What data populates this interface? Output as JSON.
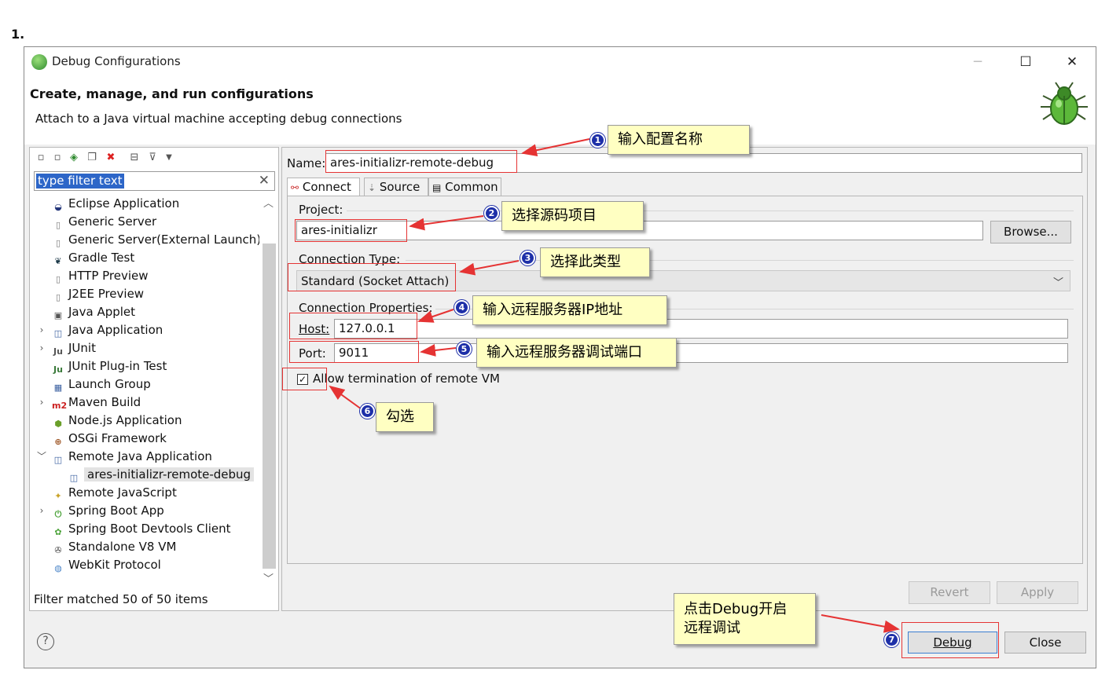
{
  "step_label": "1.",
  "window": {
    "title": "Debug Configurations",
    "header_title": "Create, manage, and run configurations",
    "header_subtitle": "Attach to a Java virtual machine accepting debug connections"
  },
  "left": {
    "filter_placeholder": "type filter text",
    "tree": [
      {
        "label": "Eclipse Application",
        "icon": "eclipse-icon",
        "expandable": false
      },
      {
        "label": "Generic Server",
        "icon": "server-icon",
        "expandable": false
      },
      {
        "label": "Generic Server(External Launch)",
        "icon": "server-icon",
        "expandable": false
      },
      {
        "label": "Gradle Test",
        "icon": "gradle-icon",
        "expandable": false
      },
      {
        "label": "HTTP Preview",
        "icon": "server-icon",
        "expandable": false
      },
      {
        "label": "J2EE Preview",
        "icon": "server-icon",
        "expandable": false
      },
      {
        "label": "Java Applet",
        "icon": "applet-icon",
        "expandable": false
      },
      {
        "label": "Java Application",
        "icon": "java-app-icon",
        "expandable": true
      },
      {
        "label": "JUnit",
        "icon": "junit-icon",
        "expandable": true
      },
      {
        "label": "JUnit Plug-in Test",
        "icon": "junit-plugin-icon",
        "expandable": false
      },
      {
        "label": "Launch Group",
        "icon": "launch-group-icon",
        "expandable": false
      },
      {
        "label": "Maven Build",
        "icon": "maven-icon",
        "expandable": true
      },
      {
        "label": "Node.js Application",
        "icon": "nodejs-icon",
        "expandable": false
      },
      {
        "label": "OSGi Framework",
        "icon": "osgi-icon",
        "expandable": false
      },
      {
        "label": "Remote Java Application",
        "icon": "remote-java-icon",
        "expandable": true,
        "expanded": true
      },
      {
        "label": "ares-initializr-remote-debug",
        "icon": "remote-java-icon",
        "child": true,
        "selected": true
      },
      {
        "label": "Remote JavaScript",
        "icon": "remote-js-icon",
        "expandable": false
      },
      {
        "label": "Spring Boot App",
        "icon": "spring-boot-icon",
        "expandable": true
      },
      {
        "label": "Spring Boot Devtools Client",
        "icon": "spring-devtools-icon",
        "expandable": false
      },
      {
        "label": "Standalone V8 VM",
        "icon": "v8-icon",
        "expandable": false
      },
      {
        "label": "WebKit Protocol",
        "icon": "webkit-icon",
        "expandable": false
      }
    ],
    "filter_status": "Filter matched 50 of 50 items"
  },
  "form": {
    "name_label": "Name:",
    "name_value": "ares-initializr-remote-debug",
    "tabs": [
      "Connect",
      "Source",
      "Common"
    ],
    "active_tab": "Connect",
    "project_label": "Project:",
    "project_value": "ares-initializr",
    "browse_label": "Browse...",
    "connection_type_label": "Connection Type:",
    "connection_type_value": "Standard (Socket Attach)",
    "connection_props_label": "Connection Properties:",
    "host_label": "Host:",
    "host_value": "127.0.0.1",
    "port_label": "Port:",
    "port_value": "9011",
    "allow_termination_label": "Allow termination of remote VM",
    "allow_termination_checked": true,
    "revert_label": "Revert",
    "apply_label": "Apply"
  },
  "footer": {
    "debug_label": "Debug",
    "close_label": "Close"
  },
  "annotations": {
    "n1": "输入配置名称",
    "n2": "选择源码项目",
    "n3": "选择此类型",
    "n4": "输入远程服务器IP地址",
    "n5": "输入远程服务器调试端口",
    "n6": "勾选",
    "n7_line1": "点击Debug开启",
    "n7_line2": "远程调试",
    "badges": [
      "1",
      "2",
      "3",
      "4",
      "5",
      "6",
      "7"
    ],
    "color": "#e53333"
  }
}
